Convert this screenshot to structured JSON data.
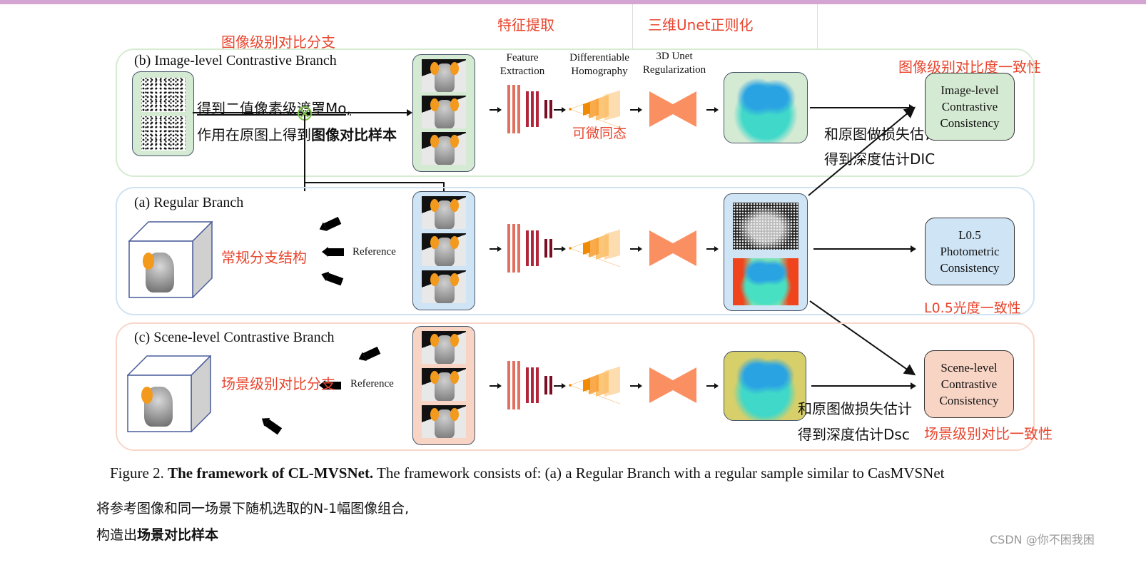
{
  "annotations_top": {
    "image_branch_cn": "图像级别对比分支",
    "feature_extraction_cn": "特征提取",
    "unet_regularization_cn": "三维Unet正则化",
    "image_consistency_cn": "图像级别对比度一致性"
  },
  "branches": {
    "image_level": {
      "title": "(b) Image-level Contrastive Branch",
      "mask_note_line1": "得到二值像素级遮罩Mo,",
      "mask_note_line2_prefix": "作用在原图上得到",
      "mask_note_line2_bold": "图像对比样本",
      "homography_note_cn": "可微同态",
      "loss_note_line1": "和原图做损失估计",
      "loss_note_line2": "得到深度估计DIC",
      "consistency_label": [
        "Image-level",
        "Contrastive",
        "Consistency"
      ]
    },
    "regular": {
      "title": "(a) Regular Branch",
      "structure_note_cn": "常规分支结构",
      "reference_label": "Reference",
      "consistency_label": [
        "L0.5",
        "Photometric",
        "Consistency"
      ],
      "consistency_note_cn": "L0.5光度一致性"
    },
    "scene_level": {
      "title": "(c) Scene-level Contrastive Branch",
      "branch_note_cn": "场景级别对比分支",
      "reference_label": "Reference",
      "loss_note_line1": "和原图做损失估计",
      "loss_note_line2": "得到深度估计Dsc",
      "consistency_label": [
        "Scene-level",
        "Contrastive",
        "Consistency"
      ],
      "consistency_note_cn": "场景级别对比一致性"
    }
  },
  "stage_labels": {
    "feature_extraction": [
      "Feature",
      "Extraction"
    ],
    "homography": [
      "Differentiable",
      "Homography"
    ],
    "unet": [
      "3D Unet",
      "Regularization"
    ]
  },
  "caption": {
    "prefix": "Figure 2. ",
    "bold": "The framework of CL-MVSNet.",
    "rest": " The framework consists of: (a) a Regular Branch with a regular sample similar to CasMVSNet"
  },
  "notes_bottom": {
    "line1": "将参考图像和同一场景下随机选取的N-1幅图像组合,",
    "line2_prefix": "构造出",
    "line2_bold": "场景对比样本"
  },
  "watermark": "CSDN @你不困我困",
  "colors": {
    "annotation_red": "#e8452e",
    "image_branch_green": "#d5ead3",
    "regular_branch_blue": "#cfe4f5",
    "scene_branch_pink": "#f8d4c4",
    "unet_orange": "#fa8f62",
    "top_bar": "#d4a5d2"
  }
}
